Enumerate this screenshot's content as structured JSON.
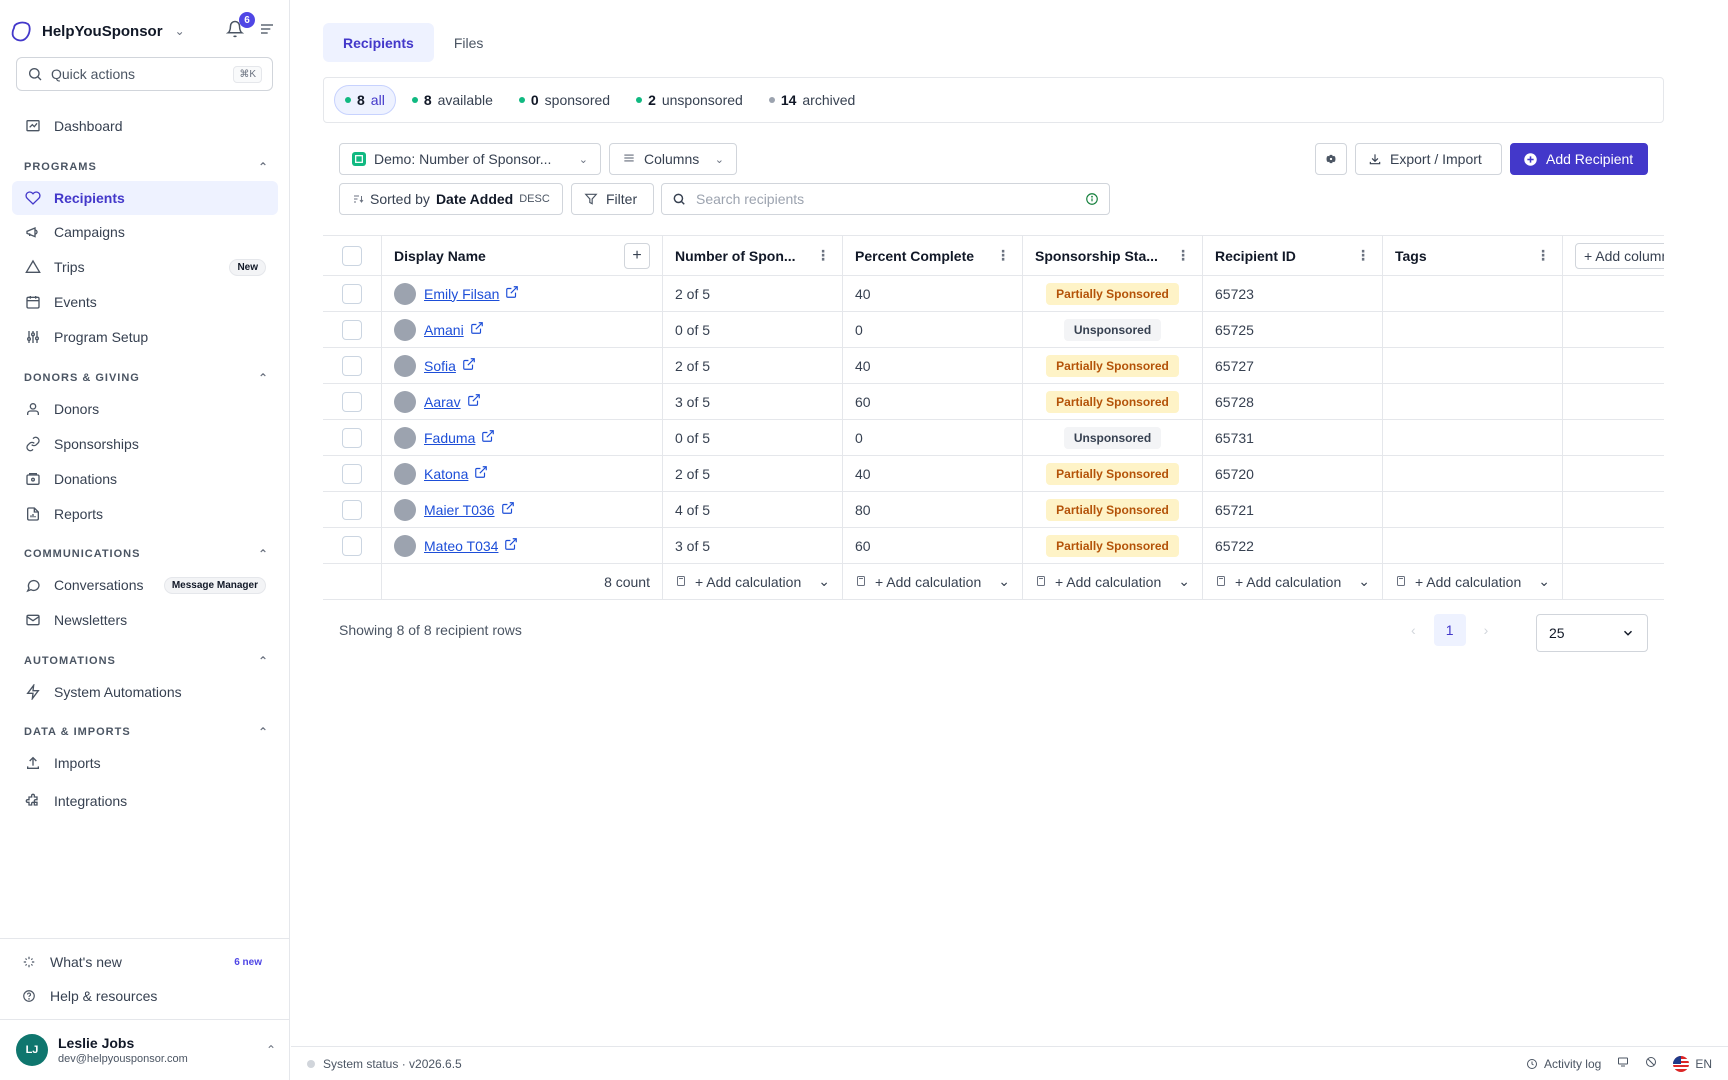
{
  "app": {
    "name": "HelpYouSponsor",
    "notifications_count": "6"
  },
  "quick_actions": {
    "label": "Quick actions",
    "shortcut": "⌘K"
  },
  "sidebar": {
    "dashboard": "Dashboard",
    "sections": {
      "programs": "PROGRAMS",
      "donors": "DONORS & GIVING",
      "communications": "COMMUNICATIONS",
      "automations": "AUTOMATIONS",
      "data": "DATA & IMPORTS"
    },
    "programs": [
      "Recipients",
      "Campaigns",
      "Trips",
      "Events",
      "Program Setup"
    ],
    "trips_badge": "New",
    "donors": [
      "Donors",
      "Sponsorships",
      "Donations",
      "Reports"
    ],
    "communications": [
      "Conversations",
      "Newsletters"
    ],
    "conversations_badge": "Message Manager",
    "automations": [
      "System Automations"
    ],
    "data": [
      "Imports",
      "Integrations"
    ],
    "whats_new": "What's new",
    "whats_new_badge": "6 new",
    "help": "Help & resources",
    "user": {
      "initials": "LJ",
      "name": "Leslie Jobs",
      "email": "dev@helpyousponsor.com"
    }
  },
  "tabs": [
    "Recipients",
    "Files"
  ],
  "status_filters": [
    {
      "count": "8",
      "label": "all"
    },
    {
      "count": "8",
      "label": "available"
    },
    {
      "count": "0",
      "label": "sponsored"
    },
    {
      "count": "2",
      "label": "unsponsored"
    },
    {
      "count": "14",
      "label": "archived"
    }
  ],
  "toolbar": {
    "view": "Demo: Number of Sponsor...",
    "columns": "Columns",
    "export": "Export / Import",
    "add": "Add Recipient",
    "sort_prefix": "Sorted by",
    "sort_field": "Date Added",
    "sort_dir": "DESC",
    "filter": "Filter",
    "search_placeholder": "Search recipients"
  },
  "table": {
    "headers": [
      "Display Name",
      "Number of Spon...",
      "Percent Complete",
      "Sponsorship Sta...",
      "Recipient ID",
      "Tags"
    ],
    "add_column": "+ Add column",
    "rows": [
      {
        "name": "Emily Filsan",
        "sponsors": "2 of 5",
        "percent": "40",
        "status": "Partially Sponsored",
        "id": "65723"
      },
      {
        "name": "Amani",
        "sponsors": "0 of 5",
        "percent": "0",
        "status": "Unsponsored",
        "id": "65725"
      },
      {
        "name": "Sofia",
        "sponsors": "2 of 5",
        "percent": "40",
        "status": "Partially Sponsored",
        "id": "65727"
      },
      {
        "name": "Aarav",
        "sponsors": "3 of 5",
        "percent": "60",
        "status": "Partially Sponsored",
        "id": "65728"
      },
      {
        "name": "Faduma",
        "sponsors": "0 of 5",
        "percent": "0",
        "status": "Unsponsored",
        "id": "65731"
      },
      {
        "name": "Katona",
        "sponsors": "2 of 5",
        "percent": "40",
        "status": "Partially Sponsored",
        "id": "65720"
      },
      {
        "name": "Maier T036",
        "sponsors": "4 of 5",
        "percent": "80",
        "status": "Partially Sponsored",
        "id": "65721"
      },
      {
        "name": "Mateo T034",
        "sponsors": "3 of 5",
        "percent": "60",
        "status": "Partially Sponsored",
        "id": "65722"
      }
    ],
    "count_label": "8 count",
    "add_calc": "+ Add calculation"
  },
  "pagination": {
    "showing": "Showing 8 of 8 recipient rows",
    "current_page": "1",
    "page_size": "25"
  },
  "footer": {
    "system_status": "System status · v2026.6.5",
    "activity_log": "Activity log",
    "language": "EN"
  }
}
